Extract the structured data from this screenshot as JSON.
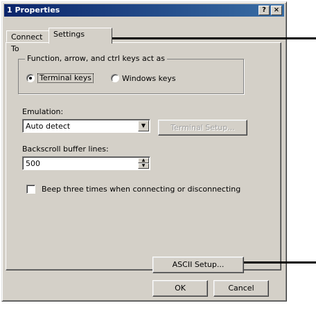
{
  "window": {
    "title": "1 Properties",
    "help_glyph": "?",
    "close_glyph": "×"
  },
  "tabs": [
    {
      "label": "Connect To",
      "selected": false
    },
    {
      "label": "Settings",
      "selected": true
    }
  ],
  "keys_group": {
    "legend": "Function, arrow, and ctrl keys act as",
    "options": [
      {
        "label": "Terminal keys",
        "checked": true
      },
      {
        "label": "Windows keys",
        "checked": false
      }
    ]
  },
  "emulation": {
    "label": "Emulation:",
    "value": "Auto detect",
    "dropdown_icon": "chevron-down-icon",
    "terminal_setup_label": "Terminal Setup..."
  },
  "backscroll": {
    "label": "Backscroll buffer lines:",
    "value": "500"
  },
  "beep": {
    "label": "Beep three times when connecting or disconnecting",
    "checked": false
  },
  "buttons": {
    "ascii_setup": "ASCII Setup...",
    "ok": "OK",
    "cancel": "Cancel"
  },
  "colors": {
    "face": "#d4d0c8",
    "title_start": "#0a246a",
    "title_end": "#3a6ea5"
  }
}
